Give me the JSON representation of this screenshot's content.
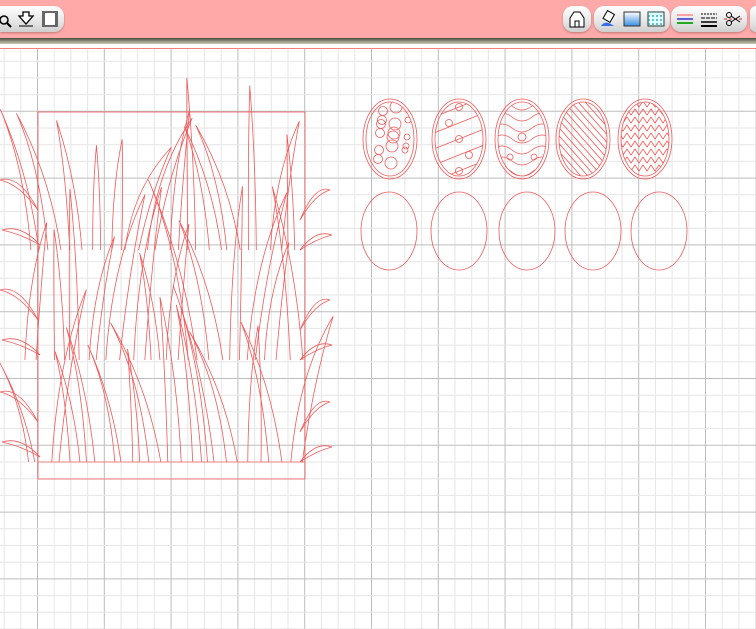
{
  "toolbar": {
    "left_group": [
      {
        "icon": "zoom-icon"
      },
      {
        "icon": "download-arrow-icon"
      },
      {
        "icon": "frame-icon"
      }
    ],
    "right_groups": [
      [
        {
          "icon": "home-icon"
        }
      ],
      [
        {
          "icon": "paint-bucket-icon"
        },
        {
          "icon": "fill-gradient-icon"
        },
        {
          "icon": "fill-pattern-icon"
        }
      ],
      [
        {
          "icon": "line-color-icon"
        },
        {
          "icon": "line-style-icon"
        },
        {
          "icon": "cut-line-icon"
        }
      ]
    ]
  },
  "colors": {
    "toolbar": "#ffaaa9",
    "stroke": "#f05a5a",
    "grid_major": "#bdbdbd",
    "grid_minor": "#e6e6e6"
  },
  "canvas": {
    "shapes": {
      "grass_panel": 1,
      "patterned_eggs": 5,
      "plain_eggs": 5
    },
    "egg_patterns": [
      "dots",
      "stripes-dots",
      "waves",
      "diagonal-lines",
      "zigzag"
    ]
  }
}
